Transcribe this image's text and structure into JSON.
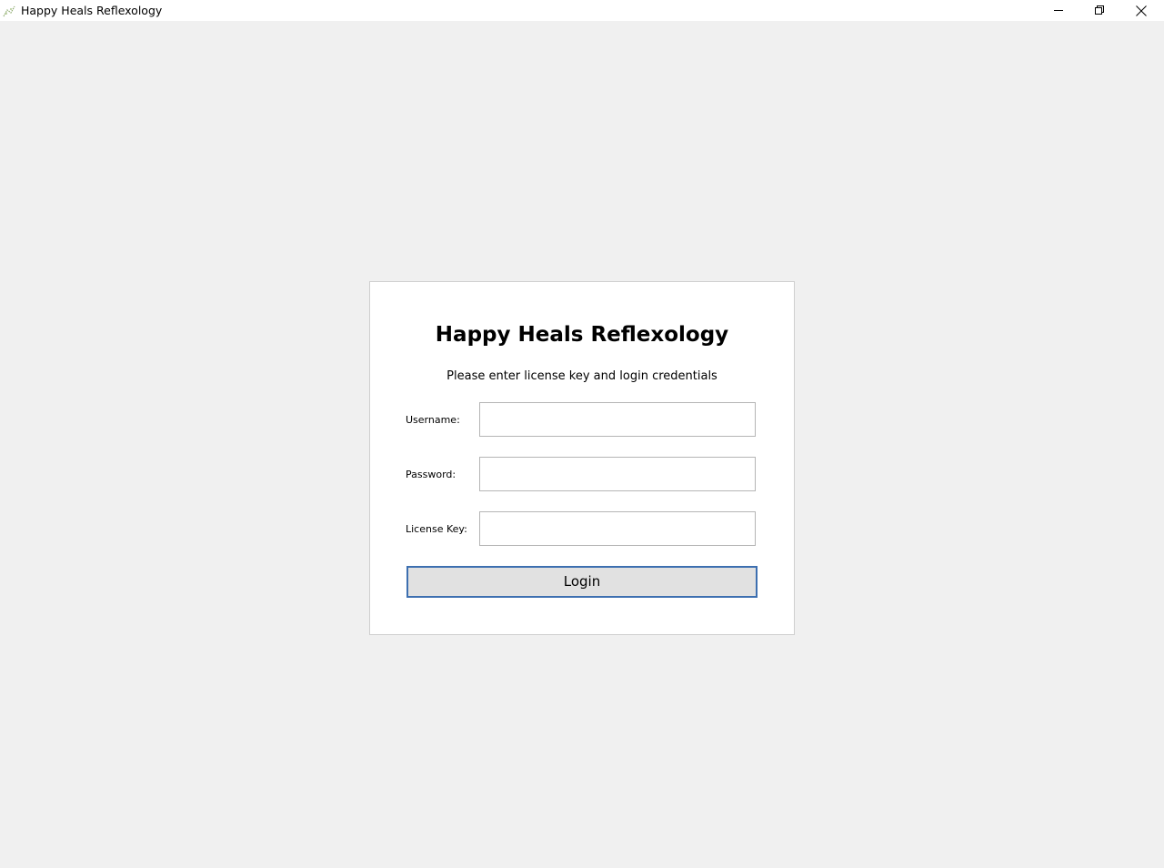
{
  "window": {
    "title": "Happy Heals Reflexology",
    "icon": "leaf-app-icon",
    "controls": {
      "minimize_icon": "minimize-icon",
      "maximize_icon": "restore-icon",
      "close_icon": "close-icon"
    }
  },
  "login": {
    "title": "Happy Heals Reflexology",
    "subtitle": "Please enter license key and login credentials",
    "fields": [
      {
        "label": "Username:",
        "value": "",
        "placeholder": ""
      },
      {
        "label": "Password:",
        "value": "",
        "placeholder": ""
      },
      {
        "label": "License Key:",
        "value": "",
        "placeholder": ""
      }
    ],
    "button_label": "Login"
  },
  "colors": {
    "background": "#f0f0f0",
    "card": "#ffffff",
    "button_border": "#3d6fb0",
    "button_fill": "#e1e1e1"
  }
}
